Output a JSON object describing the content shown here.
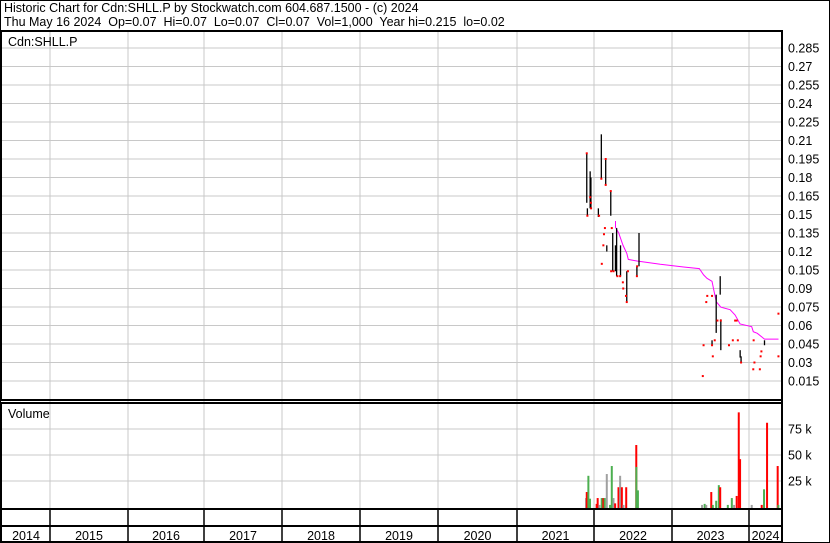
{
  "header": {
    "title": "Historic Chart for Cdn:SHLL.P by Stockwatch.com 604.687.1500 - (c) 2024",
    "summary": "Thu May 16 2024  Op=0.07  Hi=0.07  Lo=0.07  Cl=0.07  Vol=1,000  Year hi=0.215  lo=0.02"
  },
  "colors": {
    "up": "#4caf50",
    "down": "#ff0000",
    "flat": "#a0a0a0",
    "ma": "#ff00ff",
    "grid": "#c8c8c8"
  },
  "chart_data": {
    "type": "line",
    "symbol_label": "Cdn:SHLL.P",
    "volume_label": "Volume",
    "price_ticks": [
      "0.285",
      "0.27",
      "0.255",
      "0.24",
      "0.225",
      "0.21",
      "0.195",
      "0.18",
      "0.165",
      "0.15",
      "0.135",
      "0.12",
      "0.105",
      "0.09",
      "0.075",
      "0.06",
      "0.045",
      "0.03",
      "0.015"
    ],
    "price_range": [
      0.015,
      0.285
    ],
    "volume_ticks": [
      "75 k",
      "50 k",
      "25 k"
    ],
    "volume_tick_values": [
      75,
      50,
      25
    ],
    "years": [
      "2014",
      "2015",
      "2016",
      "2017",
      "2018",
      "2019",
      "2020",
      "2021",
      "2022",
      "2023",
      "2024"
    ],
    "hlc_bars": [
      {
        "t": 2021.906,
        "hi": 0.1996,
        "lo": 0.1595
      },
      {
        "t": 2021.914,
        "hi": 0.155,
        "lo": 0.149
      },
      {
        "t": 2021.95,
        "hi": 0.185,
        "lo": 0.155
      },
      {
        "t": 2021.96,
        "hi": 0.18,
        "lo": 0.155
      },
      {
        "t": 2022.056,
        "hi": 0.155,
        "lo": 0.148
      },
      {
        "t": 2022.094,
        "hi": 0.215,
        "lo": 0.179
      },
      {
        "t": 2022.15,
        "hi": 0.195,
        "lo": 0.174
      },
      {
        "t": 2022.215,
        "hi": 0.169,
        "lo": 0.149
      },
      {
        "t": 2022.164,
        "hi": 0.125,
        "lo": 0.12
      },
      {
        "t": 2022.24,
        "hi": 0.135,
        "lo": 0.104
      },
      {
        "t": 2022.275,
        "hi": 0.125,
        "lo": 0.104
      },
      {
        "t": 2022.29,
        "hi": 0.139,
        "lo": 0.1
      },
      {
        "t": 2022.34,
        "hi": 0.125,
        "lo": 0.1
      },
      {
        "t": 2022.42,
        "hi": 0.104,
        "lo": 0.079
      },
      {
        "t": 2022.55,
        "hi": 0.108,
        "lo": 0.1
      },
      {
        "t": 2022.577,
        "hi": 0.135,
        "lo": 0.108
      },
      {
        "t": 2023.52,
        "hi": 0.048,
        "lo": 0.044
      },
      {
        "t": 2023.574,
        "hi": 0.085,
        "lo": 0.054
      },
      {
        "t": 2023.626,
        "hi": 0.1,
        "lo": 0.085
      },
      {
        "t": 2023.634,
        "hi": 0.065,
        "lo": 0.04
      },
      {
        "t": 2023.885,
        "hi": 0.04,
        "lo": 0.034
      },
      {
        "t": 2023.897,
        "hi": 0.035,
        "lo": 0.03
      },
      {
        "t": 2024.2,
        "hi": 0.048,
        "lo": 0.044
      }
    ],
    "close_points": [
      [
        2021.906,
        0.1996
      ],
      [
        2021.914,
        0.149
      ],
      [
        2021.95,
        0.164
      ],
      [
        2021.96,
        0.1595
      ],
      [
        2021.962,
        0.155
      ],
      [
        2022.065,
        0.149
      ],
      [
        2022.094,
        0.179
      ],
      [
        2022.15,
        0.195
      ],
      [
        2022.15,
        0.174
      ],
      [
        2022.215,
        0.169
      ],
      [
        2022.14,
        0.139
      ],
      [
        2022.128,
        0.134
      ],
      [
        2022.228,
        0.139
      ],
      [
        2022.12,
        0.125
      ],
      [
        2022.1,
        0.11
      ],
      [
        2022.22,
        0.104
      ],
      [
        2022.25,
        0.104
      ],
      [
        2022.3,
        0.1
      ],
      [
        2022.335,
        0.1
      ],
      [
        2022.37,
        0.095
      ],
      [
        2022.375,
        0.09
      ],
      [
        2022.41,
        0.084
      ],
      [
        2022.42,
        0.079
      ],
      [
        2022.435,
        0.104
      ],
      [
        2022.55,
        0.1
      ],
      [
        2022.553,
        0.108
      ],
      [
        2023.41,
        0.044
      ],
      [
        2023.4,
        0.019
      ],
      [
        2023.445,
        0.079
      ],
      [
        2023.458,
        0.084
      ],
      [
        2023.52,
        0.084
      ],
      [
        2023.52,
        0.044
      ],
      [
        2023.53,
        0.035
      ],
      [
        2023.555,
        0.048
      ],
      [
        2023.59,
        0.064
      ],
      [
        2023.634,
        0.064
      ],
      [
        2023.74,
        0.044
      ],
      [
        2023.79,
        0.048
      ],
      [
        2023.855,
        0.048
      ],
      [
        2023.82,
        0.064
      ],
      [
        2023.84,
        0.064
      ],
      [
        2023.897,
        0.03
      ],
      [
        2024.055,
        0.0245
      ],
      [
        2024.07,
        0.03
      ],
      [
        2024.14,
        0.0245
      ],
      [
        2024.15,
        0.035
      ],
      [
        2024.16,
        0.039
      ],
      [
        2024.06,
        0.048
      ],
      [
        2024.38,
        0.0696
      ],
      [
        2024.38,
        0.035
      ]
    ],
    "moving_average": [
      [
        2022.275,
        0.1447
      ],
      [
        2022.276,
        0.1396
      ],
      [
        2022.318,
        0.1348
      ],
      [
        2022.37,
        0.1253
      ],
      [
        2022.42,
        0.1185
      ],
      [
        2022.44,
        0.1136
      ],
      [
        2022.55,
        0.1123
      ],
      [
        2022.85,
        0.1096
      ],
      [
        2023.15,
        0.1074
      ],
      [
        2023.355,
        0.1061
      ],
      [
        2023.41,
        0.101
      ],
      [
        2023.455,
        0.0983
      ],
      [
        2023.52,
        0.0958
      ],
      [
        2023.574,
        0.0793
      ],
      [
        2023.635,
        0.0748
      ],
      [
        2023.755,
        0.0728
      ],
      [
        2023.82,
        0.0685
      ],
      [
        2023.884,
        0.0612
      ],
      [
        2024.035,
        0.059
      ],
      [
        2024.056,
        0.055
      ],
      [
        2024.107,
        0.0537
      ],
      [
        2024.2,
        0.049
      ],
      [
        2024.38,
        0.049
      ]
    ],
    "volume": [
      {
        "t": 2021.897,
        "v": 8.6,
        "c": "flat"
      },
      {
        "t": 2021.906,
        "v": 14.4,
        "c": "down"
      },
      {
        "t": 2021.927,
        "v": 30,
        "c": "up"
      },
      {
        "t": 2021.948,
        "v": 8,
        "c": "up"
      },
      {
        "t": 2022.034,
        "v": 3,
        "c": "down"
      },
      {
        "t": 2022.047,
        "v": 8.6,
        "c": "down"
      },
      {
        "t": 2022.069,
        "v": 2,
        "c": "flat"
      },
      {
        "t": 2022.099,
        "v": 8.6,
        "c": "up"
      },
      {
        "t": 2022.12,
        "v": 8.6,
        "c": "down"
      },
      {
        "t": 2022.138,
        "v": 8.6,
        "c": "up"
      },
      {
        "t": 2022.164,
        "v": 31.7,
        "c": "flat"
      },
      {
        "t": 2022.206,
        "v": 2,
        "c": "up"
      },
      {
        "t": 2022.228,
        "v": 39.4,
        "c": "up"
      },
      {
        "t": 2022.25,
        "v": 8.6,
        "c": "flat"
      },
      {
        "t": 2022.271,
        "v": 3.5,
        "c": "down"
      },
      {
        "t": 2022.314,
        "v": 19,
        "c": "down"
      },
      {
        "t": 2022.335,
        "v": 30,
        "c": "flat"
      },
      {
        "t": 2022.357,
        "v": 19,
        "c": "down"
      },
      {
        "t": 2022.378,
        "v": 2,
        "c": "flat"
      },
      {
        "t": 2022.413,
        "v": 19,
        "c": "down"
      },
      {
        "t": 2022.542,
        "v": 59.6,
        "c": "down"
      },
      {
        "t": 2022.543,
        "v": 38.5,
        "c": "up"
      },
      {
        "t": 2022.563,
        "v": 16,
        "c": "up"
      },
      {
        "t": 2023.39,
        "v": 2,
        "c": "flat"
      },
      {
        "t": 2023.424,
        "v": 3,
        "c": "up"
      },
      {
        "t": 2023.445,
        "v": 2,
        "c": "flat"
      },
      {
        "t": 2023.51,
        "v": 14.4,
        "c": "down"
      },
      {
        "t": 2023.53,
        "v": 2,
        "c": "up"
      },
      {
        "t": 2023.574,
        "v": 6,
        "c": "up"
      },
      {
        "t": 2023.608,
        "v": 21,
        "c": "up"
      },
      {
        "t": 2023.626,
        "v": 19,
        "c": "down"
      },
      {
        "t": 2023.725,
        "v": 2,
        "c": "up"
      },
      {
        "t": 2023.777,
        "v": 8.6,
        "c": "up"
      },
      {
        "t": 2023.806,
        "v": 2,
        "c": "flat"
      },
      {
        "t": 2023.84,
        "v": 10.6,
        "c": "down"
      },
      {
        "t": 2023.867,
        "v": 91,
        "c": "down"
      },
      {
        "t": 2023.884,
        "v": 46,
        "c": "down"
      },
      {
        "t": 2024.035,
        "v": 2,
        "c": "flat"
      },
      {
        "t": 2024.164,
        "v": 2,
        "c": "down"
      },
      {
        "t": 2024.194,
        "v": 17,
        "c": "up"
      },
      {
        "t": 2024.233,
        "v": 81,
        "c": "down"
      },
      {
        "t": 2024.37,
        "v": 39.4,
        "c": "down"
      },
      {
        "t": 2024.378,
        "v": 2,
        "c": "up"
      }
    ]
  }
}
